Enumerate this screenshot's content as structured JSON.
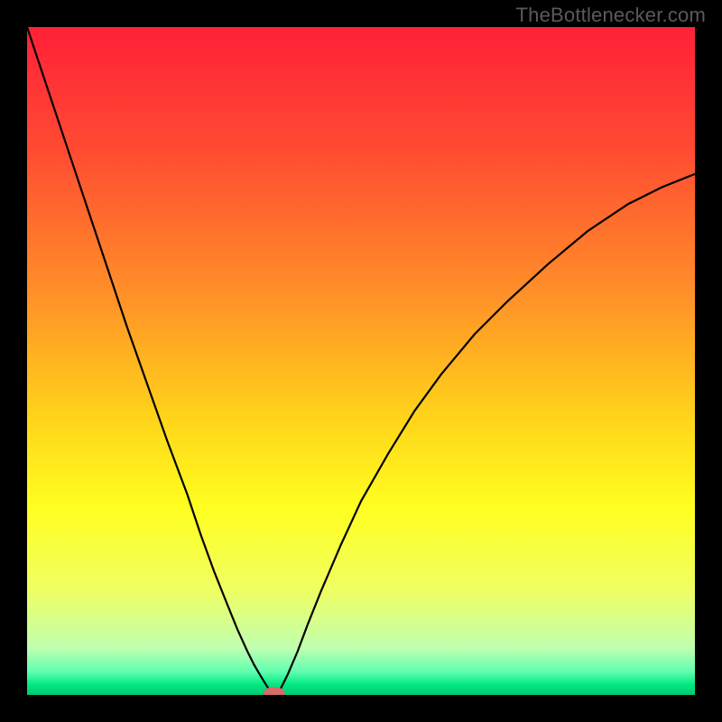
{
  "watermark": "TheBottlenecker.com",
  "chart_data": {
    "type": "line",
    "title": "",
    "xlabel": "",
    "ylabel": "",
    "xlim": [
      0,
      100
    ],
    "ylim": [
      0,
      100
    ],
    "background_gradient": {
      "stops": [
        {
          "pos": 0.0,
          "color": "#ff2038"
        },
        {
          "pos": 0.18,
          "color": "#ff4a32"
        },
        {
          "pos": 0.4,
          "color": "#ff9028"
        },
        {
          "pos": 0.58,
          "color": "#ffd21a"
        },
        {
          "pos": 0.72,
          "color": "#ffff20"
        },
        {
          "pos": 0.84,
          "color": "#f0ff60"
        },
        {
          "pos": 0.93,
          "color": "#c0ffb0"
        },
        {
          "pos": 0.965,
          "color": "#60ffb0"
        },
        {
          "pos": 0.985,
          "color": "#00e880"
        },
        {
          "pos": 1.0,
          "color": "#00c870"
        }
      ]
    },
    "series": [
      {
        "name": "bottleneck-curve",
        "color": "#000000",
        "x": [
          0,
          3,
          6,
          9,
          12,
          15,
          18,
          21,
          24,
          26,
          28,
          30,
          31.5,
          33,
          34,
          35,
          35.8,
          36.3,
          36.7,
          37,
          37.4,
          38,
          39,
          40.5,
          42,
          44,
          47,
          50,
          54,
          58,
          62,
          67,
          72,
          78,
          84,
          90,
          95,
          100
        ],
        "y": [
          100,
          91,
          82,
          73,
          64,
          55,
          46.5,
          38,
          30,
          24,
          18.5,
          13.5,
          9.8,
          6.5,
          4.5,
          2.8,
          1.5,
          0.7,
          0.25,
          0.1,
          0.25,
          1.0,
          3.0,
          6.5,
          10.5,
          15.5,
          22.5,
          29,
          36,
          42.5,
          48,
          54,
          59,
          64.5,
          69.5,
          73.5,
          76,
          78
        ]
      }
    ],
    "marker": {
      "name": "optimal-point",
      "x": 37,
      "y": 0.3,
      "color": "#d86a6a",
      "rx": 1.6,
      "ry": 0.9
    }
  }
}
